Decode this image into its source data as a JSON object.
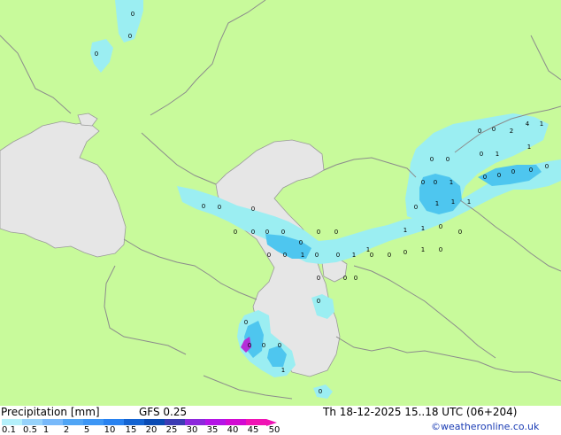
{
  "legend": {
    "title": "Precipitation [mm]",
    "model": "GFS 0.25",
    "datetime": "Th 18-12-2025 15..18 UTC (06+204)",
    "credit": "©weatheronline.co.uk",
    "scale_labels": [
      "0.1",
      "0.5",
      "1",
      "2",
      "5",
      "10",
      "15",
      "20",
      "25",
      "30",
      "35",
      "40",
      "45",
      "50"
    ],
    "scale_colors": [
      "#b4f0fa",
      "#96d2fa",
      "#78b9fa",
      "#50a5f5",
      "#3c96f5",
      "#2882f0",
      "#1464d2",
      "#0a4bb4",
      "#3c3cb4",
      "#8c28dc",
      "#b414e6",
      "#d20ad2",
      "#f014b4"
    ]
  },
  "map": {
    "colors": {
      "land": "#c8fa9b",
      "water": "#e6e6e6",
      "precip_light": "#9beef2",
      "precip_mid": "#4ec6ef",
      "precip_heavy": "#3aa0e8",
      "precip_max": "#b42ed8",
      "border": "#8c8c8c"
    },
    "point_values": [
      "0",
      "0",
      "0",
      "0",
      "0",
      "0",
      "0",
      "0",
      "0",
      "0",
      "0",
      "1",
      "0",
      "0",
      "1",
      "0",
      "0",
      "0",
      "1",
      "0",
      "1",
      "1",
      "0",
      "1",
      "0",
      "0",
      "0",
      "0",
      "0",
      "0",
      "0",
      "0",
      "1",
      "0",
      "0",
      "0",
      "0",
      "1",
      "0",
      "1",
      "1",
      "1",
      "0",
      "0",
      "0",
      "0",
      "0",
      "0",
      "0",
      "2",
      "4",
      "1",
      "1",
      "0",
      "1",
      "0",
      "0",
      "0",
      "0",
      "0",
      "0"
    ]
  }
}
